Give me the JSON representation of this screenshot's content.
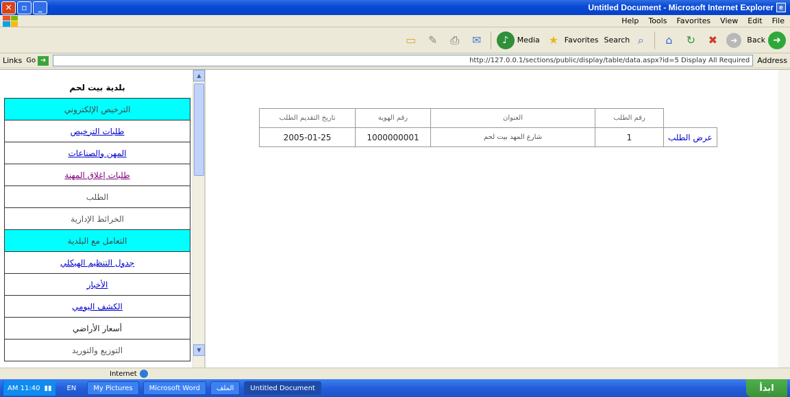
{
  "window": {
    "title": "Untitled Document - Microsoft Internet Explorer",
    "close_glyph": "✕",
    "max_glyph": "▫",
    "min_glyph": "_",
    "icon_glyph": "e"
  },
  "menu": {
    "items": [
      "Help",
      "Tools",
      "Favorites",
      "View",
      "Edit",
      "File"
    ]
  },
  "toolbar": {
    "media_label": "Media",
    "favorites_label": "Favorites",
    "search_label": "Search",
    "back_label": "Back"
  },
  "address": {
    "label": "Address",
    "url": "http://127.0.0.1/sections/public/display/table/data.aspx?id=5 Display All Required",
    "go_label": "Go",
    "links_label": "Links"
  },
  "nav": {
    "header": "بلدية بيت لحم",
    "section1": "الترخيص الإلكتروني",
    "items1": [
      "طلبات الترخيص",
      "المهن والصناعات",
      "طلبات إغلاق المهنة",
      "الطلب",
      "الخرائط الإدارية"
    ],
    "section2": "التعامل مع البلدية",
    "items2": [
      "جدول التنظيم الهيكلي",
      "الأخبار",
      "الكشف اليومي",
      "أسعار الأراضي",
      "التوزيع والتوريد"
    ]
  },
  "table": {
    "headers": [
      "رقم الطلب",
      "العنوان",
      "رقم الهوية",
      "تاريخ التقديم الطلب"
    ],
    "rows": [
      {
        "action": "عرض الطلب",
        "number": "1",
        "address": "شارع المهد بيت لحم",
        "id_number": "1000000001",
        "date": "2005-01-25"
      }
    ]
  },
  "status": {
    "text": "Internet"
  },
  "taskbar": {
    "clock": "AM 11:40",
    "lang": "EN",
    "tasks": [
      "My Pictures",
      "Microsoft Word",
      "الملف",
      "Untitled Document"
    ],
    "start": "ابدأ"
  }
}
